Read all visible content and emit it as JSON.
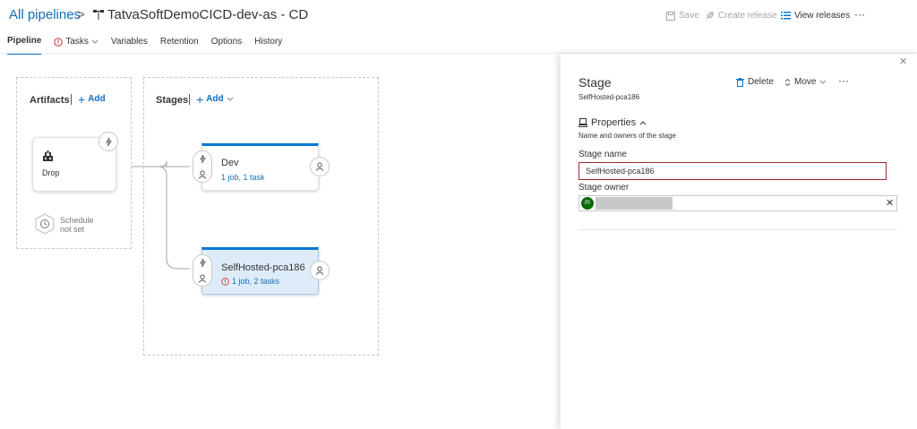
{
  "header": {
    "breadcrumb_root": "All pipelines",
    "breadcrumb_separator": ">",
    "pipeline_title": "TatvaSoftDemoCICD-dev-as - CD",
    "toolbar": {
      "save": "Save",
      "create_release": "Create release",
      "view_releases": "View releases",
      "more": "···"
    }
  },
  "tabs": [
    {
      "label": "Pipeline",
      "selected": true
    },
    {
      "label": "Tasks",
      "selected": false
    },
    {
      "label": "Variables",
      "selected": false
    },
    {
      "label": "Retention",
      "selected": false
    },
    {
      "label": "Options",
      "selected": false
    },
    {
      "label": "History",
      "selected": false
    }
  ],
  "artifacts": {
    "title": "Artifacts",
    "add_label": "Add",
    "artifact_name": "Drop",
    "schedule_line1": "Schedule",
    "schedule_line2": "not set"
  },
  "stages": {
    "title": "Stages",
    "add_label": "Add",
    "items": [
      {
        "name": "Dev",
        "summary": "1 job, 1 task",
        "selected": false,
        "has_warning": false
      },
      {
        "name": "SelfHosted-pca186",
        "summary": "1 job, 2 tasks",
        "selected": true,
        "has_warning": true
      }
    ]
  },
  "panel": {
    "title": "Stage",
    "subtitle": "SelfHosted-pca186",
    "delete_label": "Delete",
    "move_label": "Move",
    "more": "···",
    "properties_label": "Properties",
    "properties_desc": "Name and owners of the stage",
    "stage_name_label": "Stage name",
    "stage_name_value": "SelfHosted-pca186",
    "stage_owner_label": "Stage owner",
    "owner_initials": "PI",
    "clear_icon": "✕",
    "close_icon": "✕"
  },
  "colors": {
    "accent": "#0078d4",
    "link": "#106ebe",
    "error_border": "#a4262c",
    "selected_stage_bg": "#deecf9",
    "avatar_bg": "#0b6a0b"
  }
}
